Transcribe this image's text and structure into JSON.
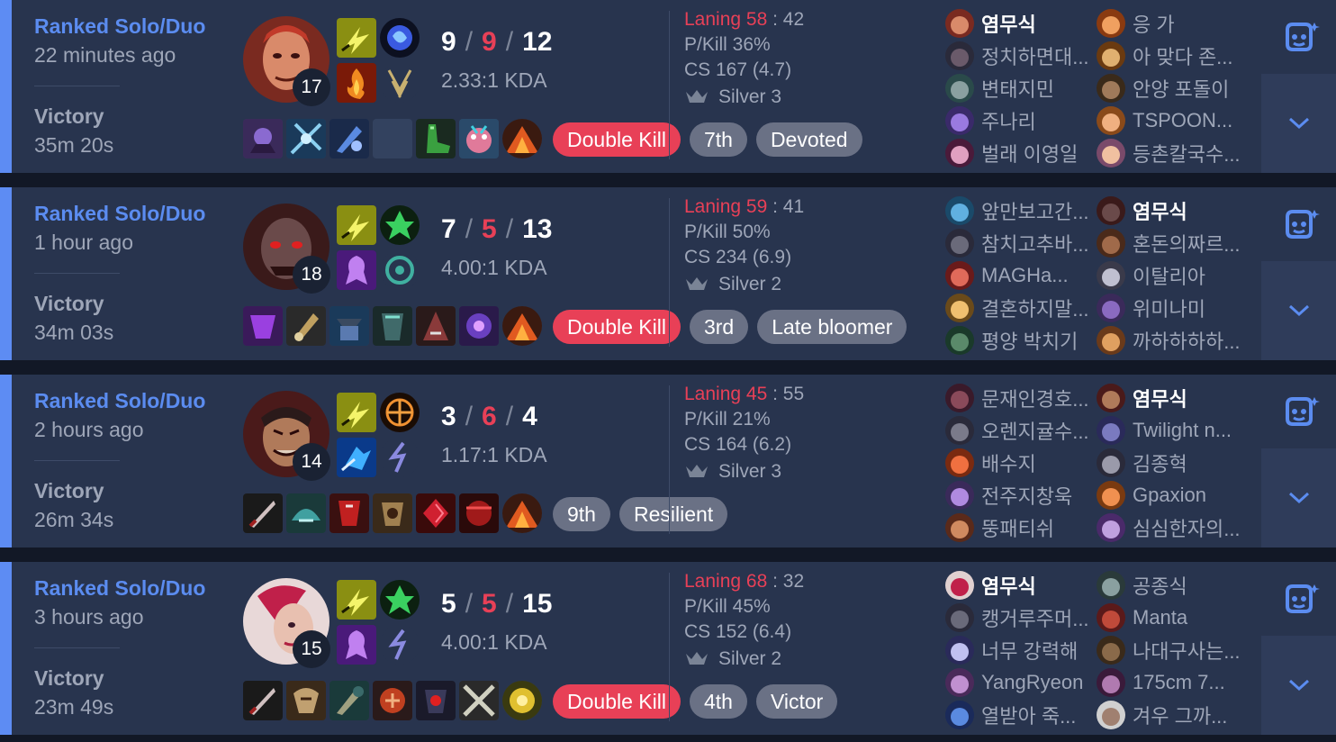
{
  "colors": {
    "accent": "#5d8cf3",
    "win_text": "#5b8cf0",
    "death_red": "#e84057",
    "card_bg": "#28344e",
    "page_bg": "#121826"
  },
  "matches": [
    {
      "queue": "Ranked Solo/Duo",
      "ago": "22 minutes ago",
      "result": "Victory",
      "duration": "35m 20s",
      "level": "17",
      "kills": "9",
      "deaths": "9",
      "assists": "12",
      "kda_ratio": "2.33:1 KDA",
      "laning_label": "Laning",
      "laning_a": "58",
      "laning_sep": " : ",
      "laning_b": "42",
      "pkill": "P/Kill 36%",
      "cs": "CS 167 (4.7)",
      "tier": "Silver 3",
      "badges": [
        "Double Kill",
        "7th",
        "Devoted"
      ],
      "team1": [
        "염무식",
        "정치하면대...",
        "변태지민",
        "주나리",
        "벌래 이영일"
      ],
      "team2": [
        "응 가",
        "아 맞다 존...",
        "안양 포돌이",
        "TSPOON...",
        "등촌칼국수..."
      ]
    },
    {
      "queue": "Ranked Solo/Duo",
      "ago": "1 hour ago",
      "result": "Victory",
      "duration": "34m 03s",
      "level": "18",
      "kills": "7",
      "deaths": "5",
      "assists": "13",
      "kda_ratio": "4.00:1 KDA",
      "laning_label": "Laning",
      "laning_a": "59",
      "laning_sep": " : ",
      "laning_b": "41",
      "pkill": "P/Kill 50%",
      "cs": "CS 234 (6.9)",
      "tier": "Silver 2",
      "badges": [
        "Double Kill",
        "3rd",
        "Late bloomer"
      ],
      "team1": [
        "앞만보고간...",
        "참치고추바...",
        "MAGHa...",
        "결혼하지말...",
        "평양 박치기"
      ],
      "team2": [
        "염무식",
        "혼돈의짜르...",
        "이탈리아",
        "위미나미",
        "까하하하하..."
      ]
    },
    {
      "queue": "Ranked Solo/Duo",
      "ago": "2 hours ago",
      "result": "Victory",
      "duration": "26m 34s",
      "level": "14",
      "kills": "3",
      "deaths": "6",
      "assists": "4",
      "kda_ratio": "1.17:1 KDA",
      "laning_label": "Laning",
      "laning_a": "45",
      "laning_sep": " : ",
      "laning_b": "55",
      "pkill": "P/Kill 21%",
      "cs": "CS 164 (6.2)",
      "tier": "Silver 3",
      "badges": [
        "9th",
        "Resilient"
      ],
      "team1": [
        "문재인경호...",
        "오렌지귤수...",
        "배수지",
        "전주지창욱",
        "뚱패티쉬"
      ],
      "team2": [
        "염무식",
        "Twilight n...",
        "김종혁",
        "Gpaxion",
        "심심한자의..."
      ]
    },
    {
      "queue": "Ranked Solo/Duo",
      "ago": "3 hours ago",
      "result": "Victory",
      "duration": "23m 49s",
      "level": "15",
      "kills": "5",
      "deaths": "5",
      "assists": "15",
      "kda_ratio": "4.00:1 KDA",
      "laning_label": "Laning",
      "laning_a": "68",
      "laning_sep": " : ",
      "laning_b": "32",
      "pkill": "P/Kill 45%",
      "cs": "CS 152 (6.4)",
      "tier": "Silver 2",
      "badges": [
        "Double Kill",
        "4th",
        "Victor"
      ],
      "team1": [
        "염무식",
        "캥거루주머...",
        "너무 강력해",
        "YangRyeon",
        "열받아 죽..."
      ],
      "team2": [
        "공종식",
        "Manta",
        "나대구사는...",
        "175cm 7...",
        "겨우 그까..."
      ]
    }
  ]
}
